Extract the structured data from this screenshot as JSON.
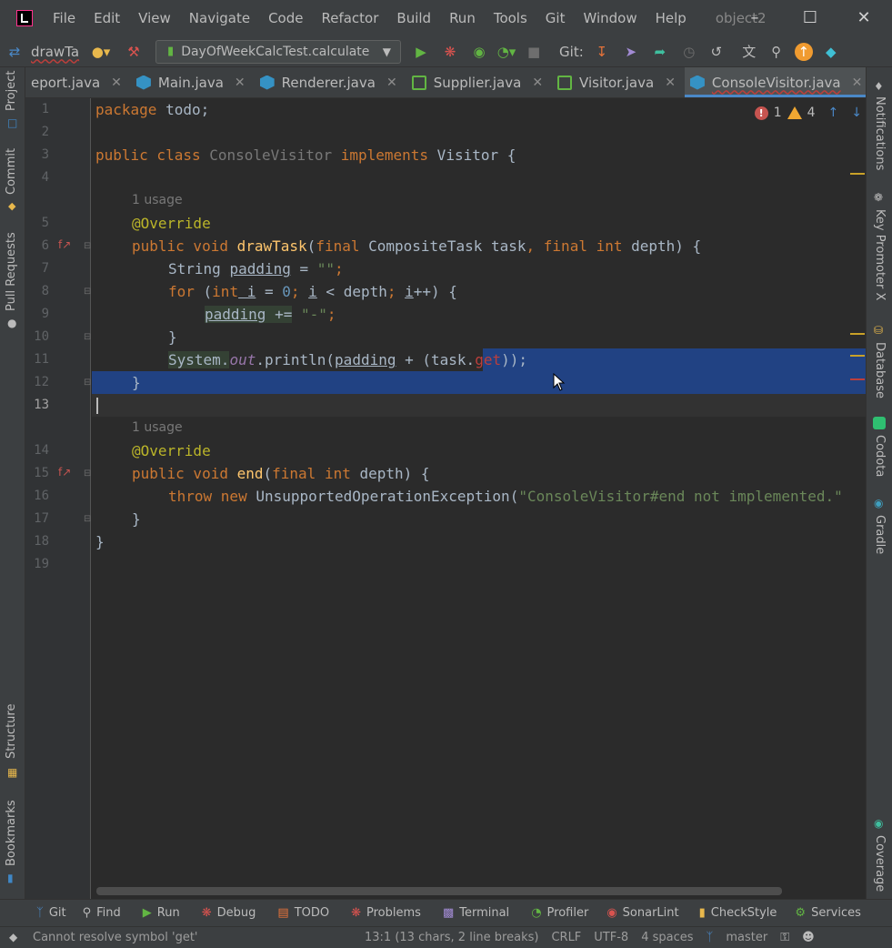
{
  "window": {
    "project_name": "object2",
    "minimize_icon": "minimize-icon",
    "maximize_icon": "maximize-icon",
    "close_icon": "close-icon"
  },
  "menu": [
    "File",
    "Edit",
    "View",
    "Navigate",
    "Code",
    "Refactor",
    "Build",
    "Run",
    "Tools",
    "Git",
    "Window",
    "Help"
  ],
  "toolbar": {
    "breadcrumb": "drawTa",
    "run_config": "DayOfWeekCalcTest.calculate",
    "git_label": "Git:"
  },
  "tabs": [
    {
      "label": "eport.java",
      "icon": "class-icon"
    },
    {
      "label": "Main.java",
      "icon": "interface-icon"
    },
    {
      "label": "Renderer.java",
      "icon": "interface-icon"
    },
    {
      "label": "Supplier.java",
      "icon": "class-icon"
    },
    {
      "label": "Visitor.java",
      "icon": "class-icon"
    },
    {
      "label": "ConsoleVisitor.java",
      "icon": "interface-icon",
      "active": true
    }
  ],
  "inspections": {
    "errors": "1",
    "warnings": "4"
  },
  "left_tools": [
    "Project",
    "Commit",
    "Pull Requests",
    "Structure",
    "Bookmarks"
  ],
  "right_tools": [
    "Notifications",
    "Key Promoter X",
    "Database",
    "Codota",
    "Gradle",
    "Coverage"
  ],
  "editor": {
    "line_numbers": [
      "1",
      "2",
      "3",
      "4",
      "5",
      "6",
      "7",
      "8",
      "9",
      "10",
      "11",
      "12",
      "13",
      "14",
      "15",
      "16",
      "17",
      "18",
      "19"
    ],
    "usage_hint": "1 usage",
    "current_line": "13",
    "lines": {
      "l1_kw": "package",
      "l1_rest": " todo;",
      "l3_kw1": "public class",
      "l3_cls": " ConsoleVisitor ",
      "l3_kw2": "implements",
      "l3_rest": " Visitor {",
      "l5_ann": "@Override",
      "l6_kw": "public void",
      "l6_fn": " drawTask",
      "l6_p1": "(",
      "l6_kw2": "final",
      "l6_type": " CompositeTask task",
      "l6_comma": ",",
      "l6_kw3": " final int",
      "l6_rest": " depth) {",
      "l7_type": "String ",
      "l7_var": "padding",
      "l7_eq": " = ",
      "l7_str": "\"\"",
      "l7_semi": ";",
      "l8_kw": "for",
      "l8_p": " (",
      "l8_kw2": "int",
      "l8_i": " i",
      "l8_eq": " = ",
      "l8_num": "0",
      "l8_semi": "; ",
      "l8_i2": "i",
      "l8_lt": " < depth",
      "l8_semi2": "; ",
      "l8_i3": "i",
      "l8_inc": "++) {",
      "l9_var": "padding",
      "l9_op": " +=",
      "l9_sp": " ",
      "l9_str": "\"-\"",
      "l9_semi": ";",
      "l10": "}",
      "l11_a": "System.",
      "l11_out": "out",
      "l11_b": ".println(",
      "l11_var": "padding",
      "l11_c": " + (task.",
      "l11_err": "get",
      "l11_d": "));",
      "l12": "}",
      "l14_ann": "@Override",
      "l15_kw": "public void",
      "l15_fn": " end",
      "l15_p": "(",
      "l15_kw2": "final int",
      "l15_rest": " depth) {",
      "l16_kw": "throw new",
      "l16_cls": " UnsupportedOperationException(",
      "l16_str": "\"ConsoleVisitor#end not implemented.\"",
      "l17": "}",
      "l18": "}"
    }
  },
  "bottom_tools": [
    {
      "label": "Git",
      "icon": "git-icon"
    },
    {
      "label": "Find",
      "icon": "find-icon"
    },
    {
      "label": "Run",
      "icon": "run-icon"
    },
    {
      "label": "Debug",
      "icon": "debug-icon"
    },
    {
      "label": "TODO",
      "icon": "todo-icon"
    },
    {
      "label": "Problems",
      "icon": "problems-icon"
    },
    {
      "label": "Terminal",
      "icon": "terminal-icon"
    },
    {
      "label": "Profiler",
      "icon": "profiler-icon"
    },
    {
      "label": "SonarLint",
      "icon": "sonarlint-icon"
    },
    {
      "label": "CheckStyle",
      "icon": "checkstyle-icon"
    },
    {
      "label": "Services",
      "icon": "services-icon"
    }
  ],
  "status": {
    "message": "Cannot resolve symbol 'get'",
    "position": "13:1 (13 chars, 2 line breaks)",
    "line_sep": "CRLF",
    "encoding": "UTF-8",
    "indent": "4 spaces",
    "branch": "master"
  }
}
